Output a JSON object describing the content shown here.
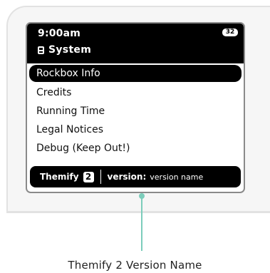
{
  "statusbar": {
    "time": "9:00am",
    "battery": "32",
    "section_title": "System"
  },
  "menu": {
    "items": [
      {
        "label": "Rockbox Info",
        "selected": true
      },
      {
        "label": "Credits",
        "selected": false
      },
      {
        "label": "Running Time",
        "selected": false
      },
      {
        "label": "Legal Notices",
        "selected": false
      },
      {
        "label": "Debug (Keep Out!)",
        "selected": false
      }
    ]
  },
  "footer": {
    "theme_name": "Themify",
    "theme_number": "2",
    "version_label": "version:",
    "version_value": "version name"
  },
  "callout": {
    "label": "Themify 2 Version Name"
  },
  "colors": {
    "accent_callout": "#7ccdbb",
    "screen_bg": "#ffffff",
    "bar_bg": "#000000"
  },
  "icons": {
    "section": "system-icon"
  }
}
